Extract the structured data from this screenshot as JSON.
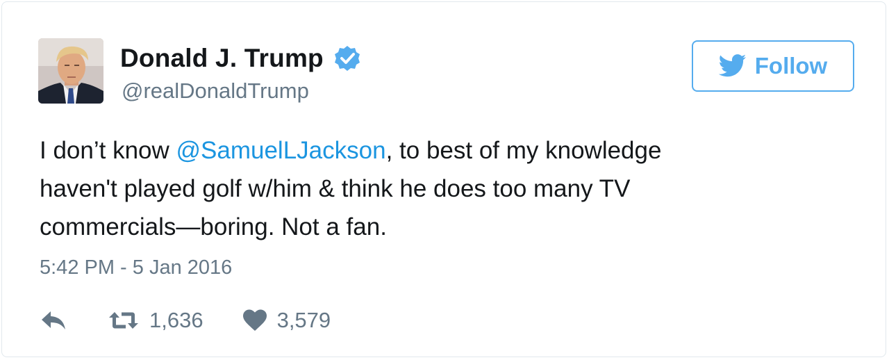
{
  "author": {
    "display_name": "Donald J. Trump",
    "handle": "@realDonaldTrump",
    "verified_icon": "verified-badge-icon",
    "avatar_icon": "profile-avatar"
  },
  "follow_button": {
    "label": "Follow",
    "icon": "twitter-bird-icon"
  },
  "tweet": {
    "line1_before": "I don’t know ",
    "mention": "@SamuelLJackson",
    "line1_after": ", to best of my knowledge",
    "line2": "haven't played golf w/him & think he does too many TV",
    "line3": "commercials—boring. Not a fan."
  },
  "timestamp": "5:42 PM - 5 Jan 2016",
  "actions": {
    "reply_icon": "reply-icon",
    "retweet_icon": "retweet-icon",
    "retweet_count": "1,636",
    "like_icon": "heart-icon",
    "like_count": "3,579"
  },
  "colors": {
    "accent": "#55acee",
    "mention": "#1b95e0",
    "muted": "#657786",
    "text": "#14171a",
    "border": "#e1e8ed"
  }
}
